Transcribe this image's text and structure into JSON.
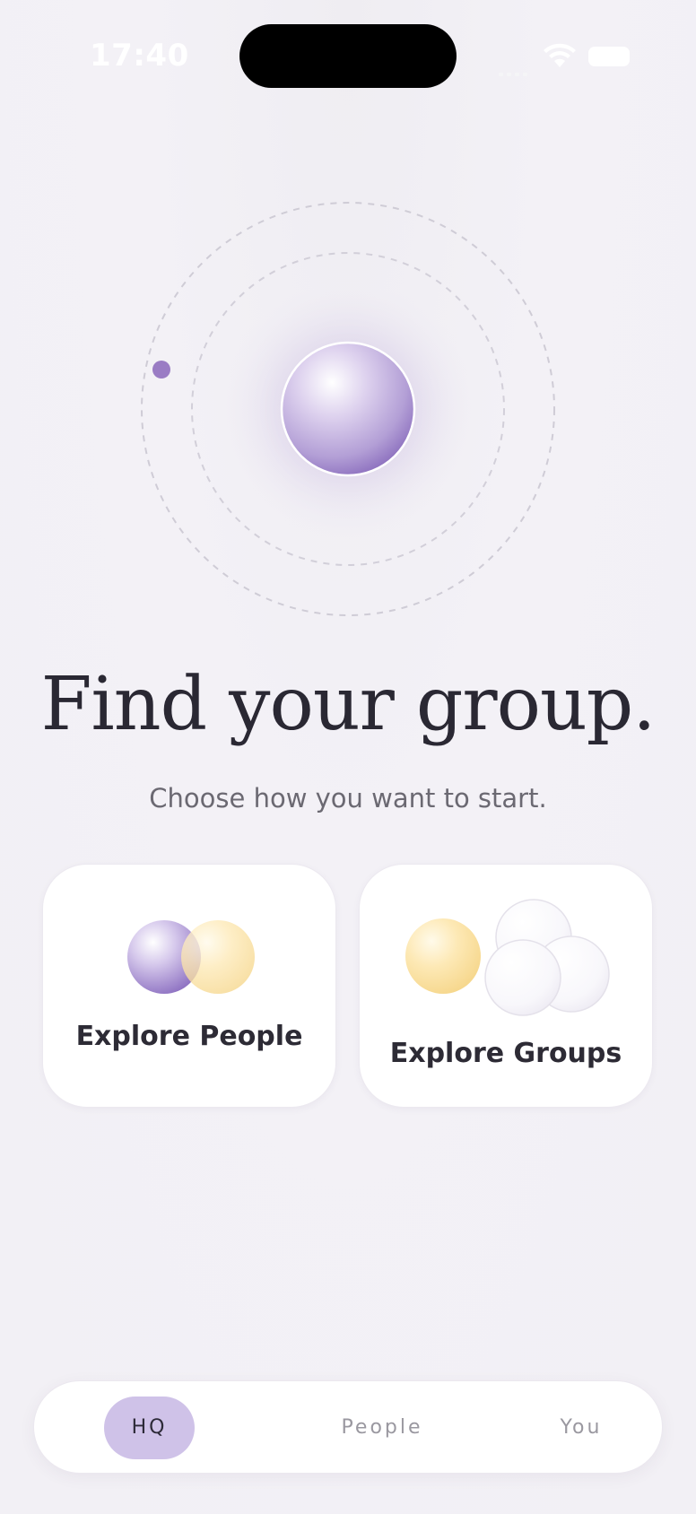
{
  "status_bar": {
    "time": "17:40"
  },
  "hero": {
    "orb_color": "#9b82c6",
    "satellite_color": "#9a7cc4"
  },
  "main": {
    "title": "Find your group.",
    "subtitle": "Choose how you want to start."
  },
  "cards": [
    {
      "label": "Explore People",
      "icon": "two-overlapping-orbs-icon"
    },
    {
      "label": "Explore Groups",
      "icon": "orb-cluster-icon"
    }
  ],
  "tab_bar": {
    "tabs": [
      {
        "label": "HQ",
        "active": true
      },
      {
        "label": "People",
        "active": false
      },
      {
        "label": "You",
        "active": false
      }
    ],
    "active_color": "#cfc2e8"
  }
}
